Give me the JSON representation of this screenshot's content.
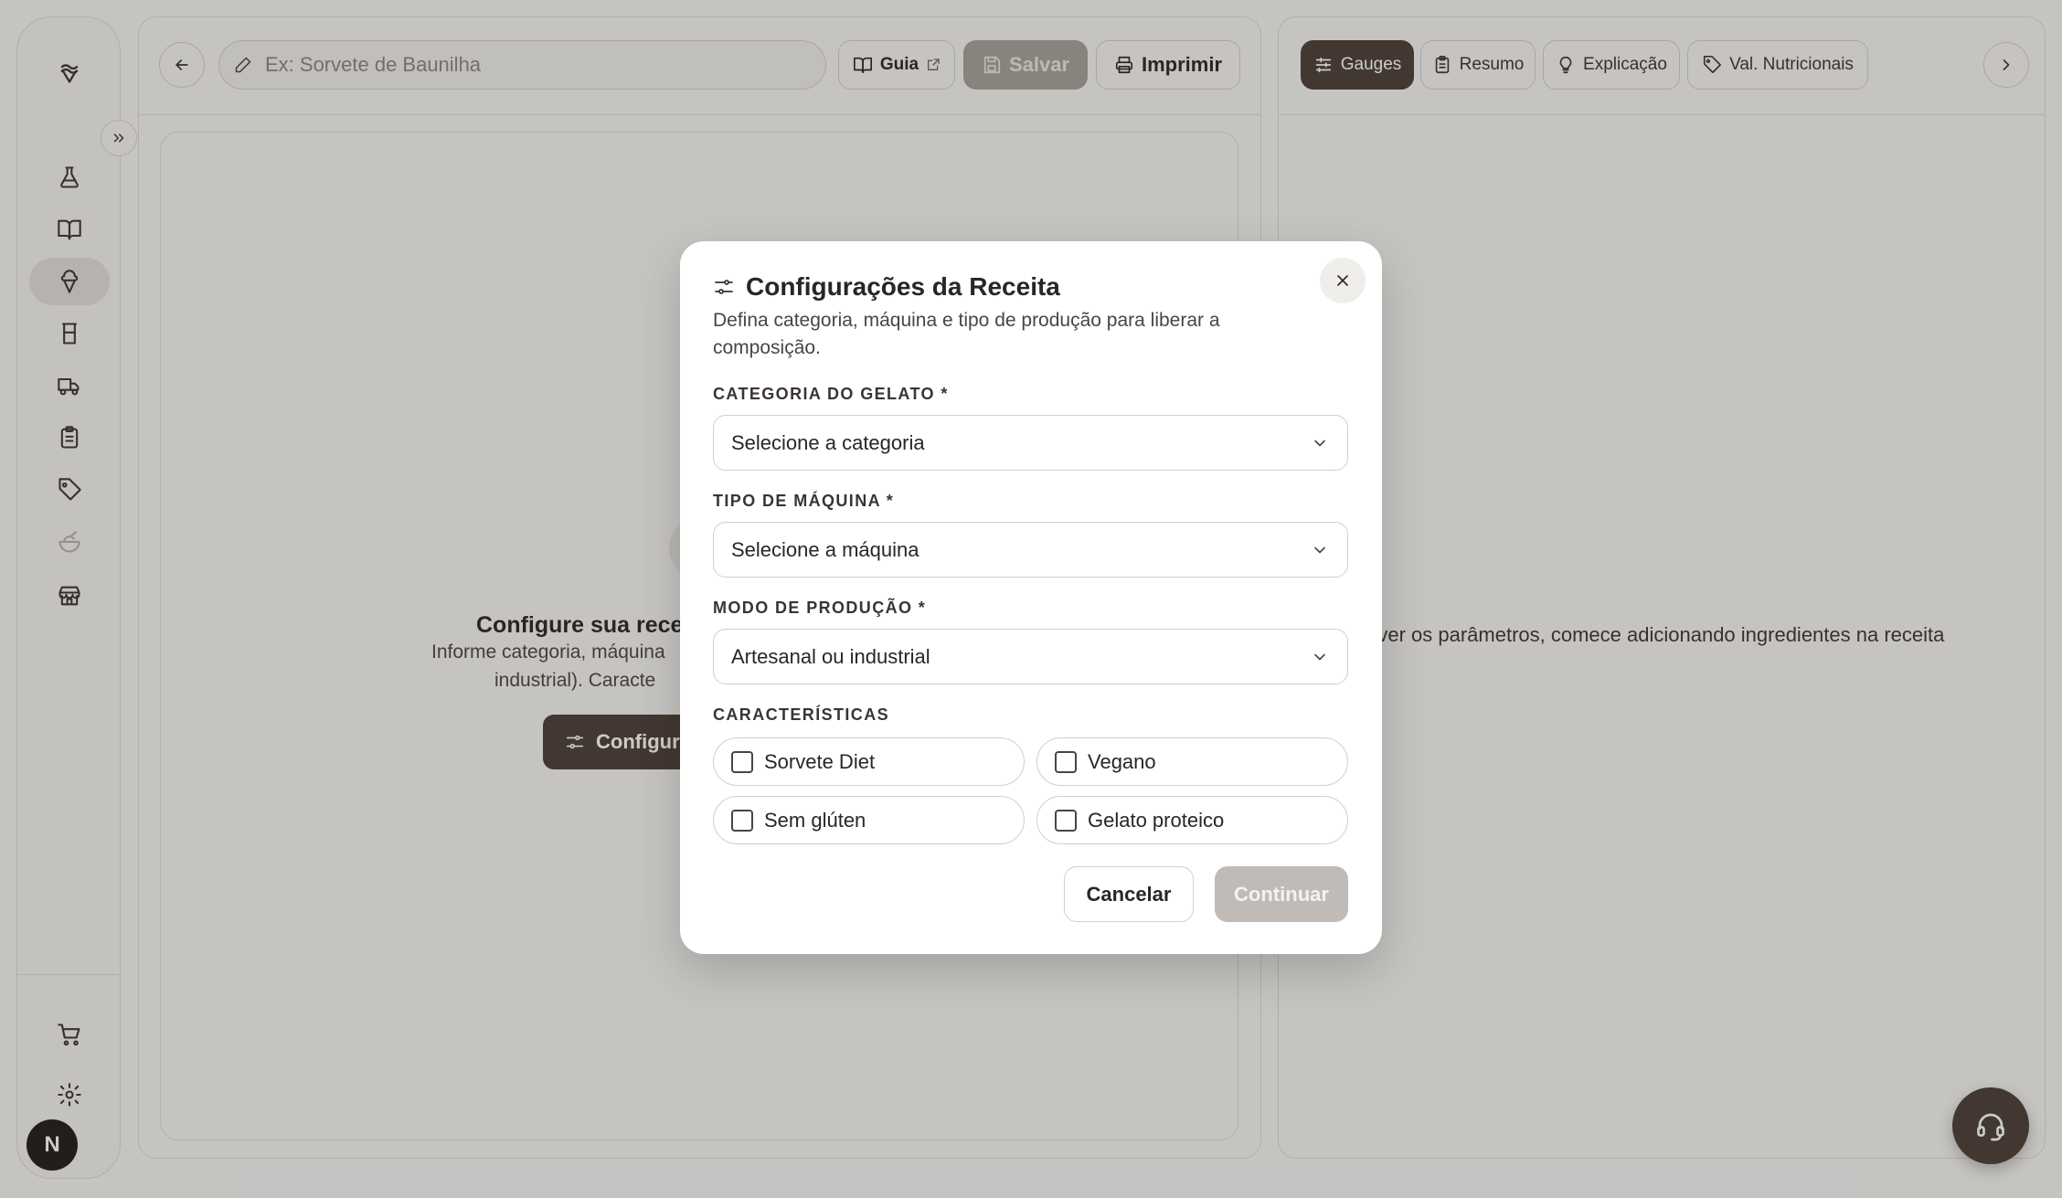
{
  "colors": {
    "accent": "#4a3e36",
    "disabled": "#a8a19a",
    "background": "#f7f6f4",
    "overlay": "rgba(40,36,34,0.24)"
  },
  "sidebar": {
    "logo_icon": "ice-cream-logo-icon",
    "items": [
      {
        "icon": "flask-icon"
      },
      {
        "icon": "book-open-icon"
      },
      {
        "icon": "ice-cream-cone-icon",
        "active": true
      },
      {
        "icon": "glass-cup-icon"
      },
      {
        "icon": "truck-icon"
      },
      {
        "icon": "clipboard-icon"
      },
      {
        "icon": "tag-icon"
      },
      {
        "icon": "salad-bowl-icon"
      },
      {
        "icon": "store-icon"
      }
    ],
    "bottom_items": [
      {
        "icon": "cart-icon"
      },
      {
        "icon": "gear-icon"
      }
    ],
    "avatar_initial": "N",
    "expand_icon": "chevrons-right-icon"
  },
  "editor": {
    "name_placeholder": "Ex: Sorvete de Baunilha",
    "guide_label": "Guia",
    "save_label": "Salvar",
    "print_label": "Imprimir",
    "empty_title": "Configure sua receita ante",
    "empty_desc_line1": "Informe categoria, máquina",
    "empty_desc_line2": "industrial). Caracte",
    "empty_button": "Configura"
  },
  "right_panel": {
    "tabs": [
      {
        "label": "Gauges",
        "icon": "sliders-icon",
        "active": true
      },
      {
        "label": "Resumo",
        "icon": "clipboard-list-icon"
      },
      {
        "label": "Explicação",
        "icon": "lightbulb-icon"
      },
      {
        "label": "Val. Nutricionais",
        "icon": "tag-icon"
      }
    ],
    "empty_text": "a ver os parâmetros, comece adicionando ingredientes na receita"
  },
  "modal": {
    "title": "Configurações da Receita",
    "description": "Defina categoria, máquina e tipo de produção para liberar a composição.",
    "category_label": "CATEGORIA DO GELATO *",
    "category_value": "Selecione a categoria",
    "machine_label": "TIPO DE MÁQUINA *",
    "machine_value": "Selecione a máquina",
    "mode_label": "MODO DE PRODUÇÃO *",
    "mode_value": "Artesanal ou industrial",
    "features_label": "CARACTERÍSTICAS",
    "features": [
      {
        "label": "Sorvete Diet",
        "checked": false
      },
      {
        "label": "Vegano",
        "checked": false
      },
      {
        "label": "Sem glúten",
        "checked": false
      },
      {
        "label": "Gelato proteico",
        "checked": false
      }
    ],
    "cancel_label": "Cancelar",
    "continue_label": "Continuar"
  }
}
